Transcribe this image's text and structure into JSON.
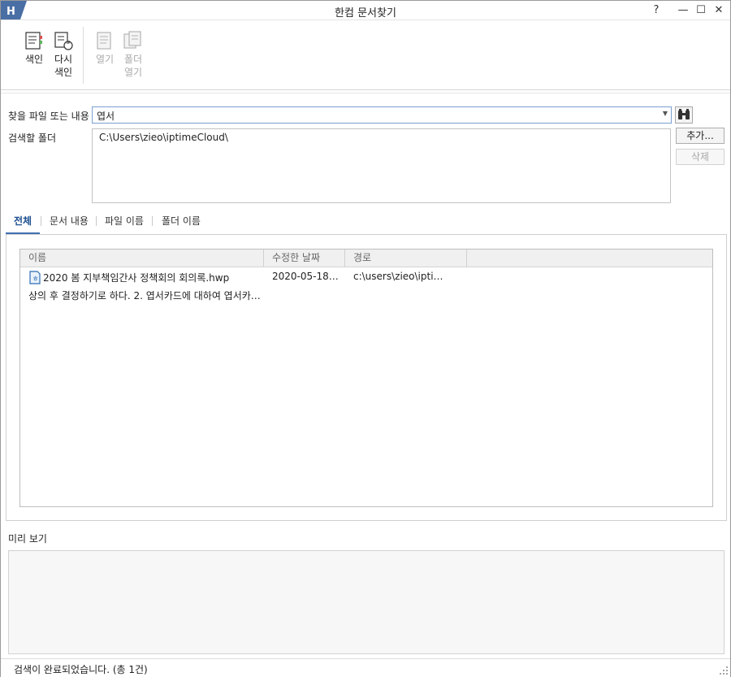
{
  "window": {
    "title": "한컴 문서찾기",
    "help": "?",
    "minimize": "—",
    "maximize": "☐",
    "close": "✕"
  },
  "ribbon": {
    "index": "색인",
    "reindex_1": "다시",
    "reindex_2": "색인",
    "open": "열기",
    "open_folder_1": "폴더",
    "open_folder_2": "열기"
  },
  "search": {
    "query_label": "찾을 파일 또는 내용",
    "query_value": "엽서",
    "folder_label": "검색할 폴더",
    "folder_value": "C:\\Users\\zieo\\iptimeCloud\\",
    "add_button": "추가...",
    "delete_button": "삭제"
  },
  "tabs": [
    "전체",
    "문서 내용",
    "파일 이름",
    "폴더 이름"
  ],
  "results": {
    "columns": [
      "이름",
      "수정한 날짜",
      "경로"
    ],
    "rows": [
      {
        "name": "2020 봄 지부책임간사 정책회의 회의록.hwp",
        "date": "2020-05-18…",
        "path": "c:\\users\\zieo\\ipti…",
        "snippet": "상의 후 결정하기로 하다.  2. 엽서카드에 대하여 엽서카…"
      }
    ]
  },
  "preview": {
    "label": "미리 보기"
  },
  "status": {
    "text": "검색이 완료되었습니다. (총 1건)"
  },
  "colors": {
    "accent": "#1d4f91",
    "tab_underline": "#4170b0",
    "app_icon": "#4a6fa5"
  }
}
